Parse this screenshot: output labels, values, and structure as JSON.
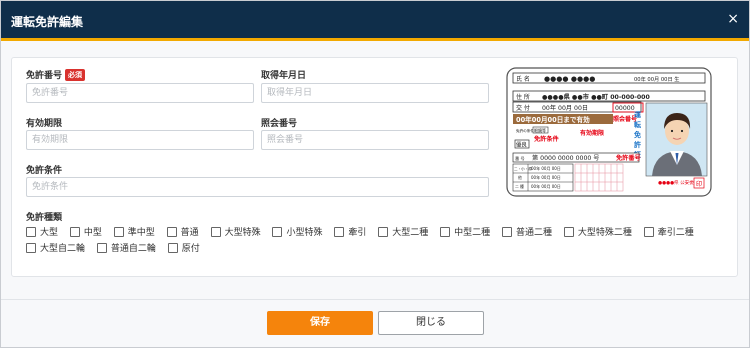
{
  "dialog": {
    "title": "運転免許編集",
    "close_glyph": "×"
  },
  "form": {
    "license_number": {
      "label": "免許番号",
      "required_badge": "必須",
      "placeholder": "免許番号",
      "value": ""
    },
    "acquired_date": {
      "label": "取得年月日",
      "placeholder": "取得年月日",
      "value": ""
    },
    "expiry": {
      "label": "有効期限",
      "placeholder": "有効期限",
      "value": ""
    },
    "reference_number": {
      "label": "照会番号",
      "placeholder": "照会番号",
      "value": ""
    },
    "conditions": {
      "label": "免許条件",
      "placeholder": "免許条件",
      "value": ""
    },
    "license_types": {
      "label": "免許種類",
      "row1": [
        "大型",
        "中型",
        "準中型",
        "普通",
        "大型特殊",
        "小型特殊",
        "牽引",
        "大型二種",
        "中型二種",
        "普通二種",
        "大型特殊二種",
        "牽引二種"
      ],
      "row2": [
        "大型自二輪",
        "普通自二輪",
        "原付"
      ]
    }
  },
  "license_card": {
    "name_label": "氏 名",
    "name_value": "●●●● ●●●●",
    "birth": "00年 00月 00日 生",
    "address_label": "住 所",
    "address_value": "●●●●県 ●●市 ●●町 00-000-000",
    "issue_label": "交 付",
    "issue_value": "00年 00月 00日",
    "issue_number": "00000",
    "reference_label": "照会番号",
    "expiry_band": "00年00月00日まで有効",
    "expiry_label": "有効期限",
    "vertical_text": [
      "運",
      "転",
      "免",
      "許",
      "証"
    ],
    "conditions_small": "免許の条件等",
    "condition_stamp": "眼鏡等",
    "conditions_label": "免許条件",
    "gold": "優良",
    "number_label": "番 号",
    "number_value": "第 0000 0000 0000 号",
    "license_number_label": "免許番号",
    "history": [
      {
        "label": "二・小・原",
        "value": "00年 00月 00日"
      },
      {
        "label": "他",
        "value": "00年 00月 00日"
      },
      {
        "label": "二 種",
        "value": "00年 00月 00日"
      }
    ],
    "issuer": "●●●●県\n公安委員会",
    "seal": "印"
  },
  "footer": {
    "save_label": "保存",
    "close_label": "閉じる"
  },
  "colors": {
    "header_bg": "#0f2e4a",
    "header_accent": "#f2a900",
    "save_button": "#f5840c",
    "required_badge": "#d9322e",
    "card_annotation": "#e60012"
  }
}
